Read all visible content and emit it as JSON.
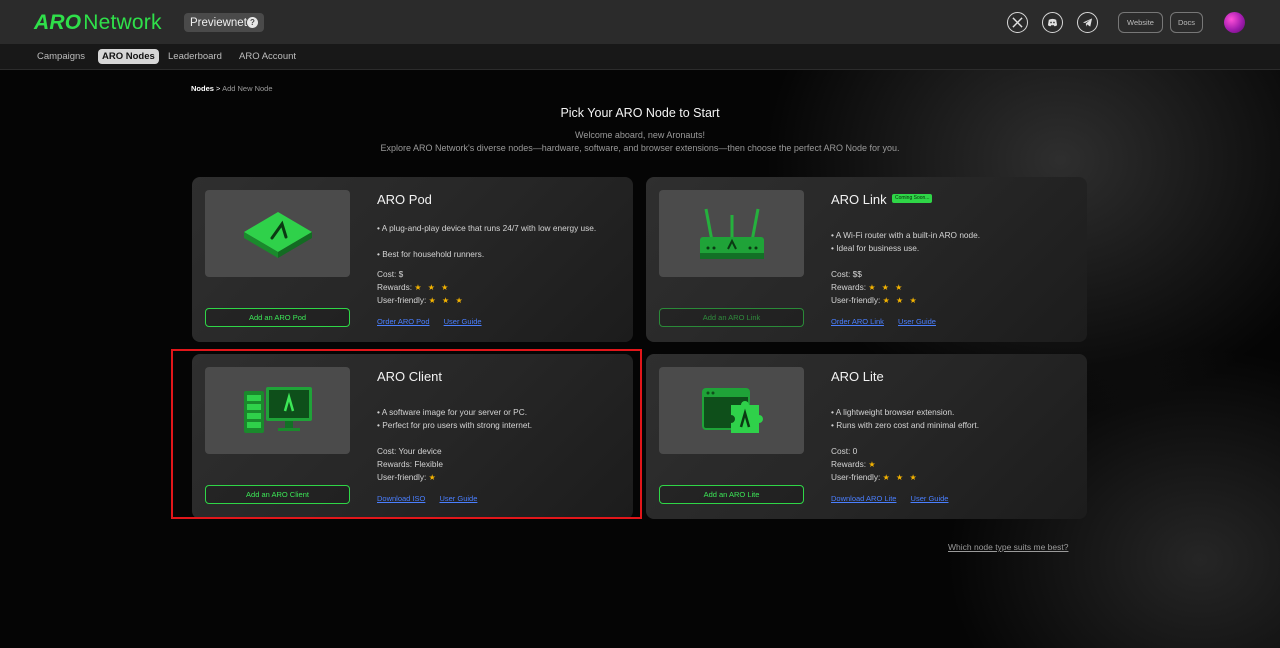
{
  "header": {
    "logo_aro": "ARO",
    "logo_network": "Network",
    "env_badge": "Previewnet",
    "env_badge_icon": "?",
    "social": [
      "x-icon",
      "discord-icon",
      "telegram-icon"
    ],
    "website_label": "Website",
    "docs_label": "Docs"
  },
  "nav": {
    "items": [
      {
        "label": "Campaigns",
        "active": false
      },
      {
        "label": "ARO Nodes",
        "active": true
      },
      {
        "label": "Leaderboard",
        "active": false
      },
      {
        "label": "ARO Account",
        "active": false
      }
    ]
  },
  "breadcrumb": {
    "root": "Nodes",
    "separator": ">",
    "current": "Add New Node"
  },
  "intro": {
    "title": "Pick Your ARO Node to Start",
    "line1": "Welcome aboard, new Aronauts!",
    "line2": "Explore ARO Network's diverse nodes—hardware, software, and browser extensions—then choose the perfect ARO Node for you."
  },
  "cards": [
    {
      "title": "ARO Pod",
      "badge": "",
      "desc1": "• A plug-and-play device that runs 24/7 with low energy use.",
      "desc2": "• Best for household runners.",
      "cost_label": "Cost: $",
      "rewards_label": "Rewards:",
      "rewards_stars": "★ ★ ★",
      "userfriendly_label": "User-friendly:",
      "userfriendly_stars": "★ ★ ★",
      "button": "Add an ARO Pod",
      "link1": "Order ARO Pod",
      "link2": "User Guide"
    },
    {
      "title": "ARO Link",
      "badge": "Coming Soon...",
      "desc1": "• A Wi-Fi router with a built-in ARO node.",
      "desc2": "• Ideal for business use.",
      "cost_label": "Cost: $$",
      "rewards_label": "Rewards:",
      "rewards_stars": "★ ★ ★",
      "userfriendly_label": "User-friendly:",
      "userfriendly_stars": "★ ★ ★",
      "button": "Add an ARO Link",
      "link1": "Order ARO Link",
      "link2": "User Guide"
    },
    {
      "title": "ARO Client",
      "badge": "",
      "desc1": "• A software image for your server or PC.",
      "desc2": "• Perfect for pro users with strong internet.",
      "cost_label": "Cost: Your device",
      "rewards_label": "Rewards: Flexible",
      "rewards_stars": "",
      "userfriendly_label": "User-friendly:",
      "userfriendly_stars": "★",
      "button": "Add an ARO Client",
      "link1": "Download ISO",
      "link2": "User Guide"
    },
    {
      "title": "ARO Lite",
      "badge": "",
      "desc1": "• A lightweight browser extension.",
      "desc2": "• Runs with zero cost and minimal effort.",
      "cost_label": "Cost: 0",
      "rewards_label": "Rewards:",
      "rewards_stars": "★",
      "userfriendly_label": "User-friendly:",
      "userfriendly_stars": "★ ★ ★",
      "button": "Add an ARO Lite",
      "link1": "Download ARO Lite",
      "link2": "User Guide"
    }
  ],
  "footer_link": "Which node type suits me best?",
  "colors": {
    "accent_green": "#2fe04a",
    "star_gold": "#f5b400",
    "link_blue": "#4a7fff",
    "highlight_red": "#e2161a"
  }
}
